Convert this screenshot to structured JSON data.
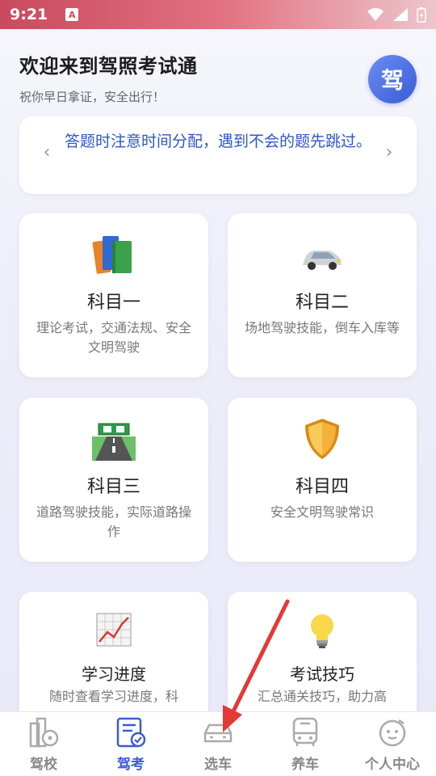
{
  "status": {
    "time": "9:21",
    "app_icon_letter": "A"
  },
  "header": {
    "title": "欢迎来到驾照考试通",
    "subtitle": "祝你早日拿证，安全出行！",
    "avatar_text": "驾"
  },
  "tip": {
    "text": "答题时注意时间分配，遇到不会的题先跳过。",
    "prev": "‹",
    "next": "›"
  },
  "cards": [
    {
      "title": "科目一",
      "desc": "理论考试，交通法规、安全文明驾驶",
      "icon": "books-icon"
    },
    {
      "title": "科目二",
      "desc": "场地驾驶技能，倒车入库等",
      "icon": "car-icon"
    },
    {
      "title": "科目三",
      "desc": "道路驾驶技能，实际道路操作",
      "icon": "road-icon"
    },
    {
      "title": "科目四",
      "desc": "安全文明驾驶常识",
      "icon": "shield-icon"
    },
    {
      "title": "学习进度",
      "desc": "随时查看学习进度，科",
      "icon": "chart-icon"
    },
    {
      "title": "考试技巧",
      "desc": "汇总通关技巧，助力高",
      "icon": "lightbulb-icon"
    }
  ],
  "nav": {
    "items": [
      {
        "label": "驾校",
        "icon": "driving-school-icon",
        "active": false
      },
      {
        "label": "驾考",
        "icon": "exam-icon",
        "active": true
      },
      {
        "label": "选车",
        "icon": "car-select-icon",
        "active": false
      },
      {
        "label": "养车",
        "icon": "bus-icon",
        "active": false
      },
      {
        "label": "个人中心",
        "icon": "profile-icon",
        "active": false
      }
    ]
  },
  "colors": {
    "accent": "#3b5bd6",
    "tip_text": "#2f56c8",
    "arrow": "#e53935"
  }
}
